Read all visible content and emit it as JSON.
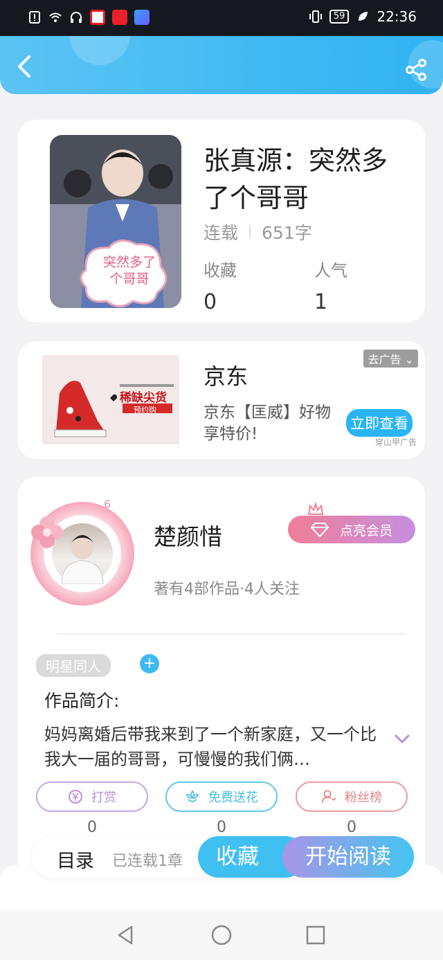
{
  "status_bar": {
    "time": "22:36",
    "battery": "59",
    "icons": [
      "alert-icon",
      "wifi-icon",
      "headset-icon",
      "weibo-icon",
      "news-icon",
      "music-icon",
      "vibrate-icon",
      "battery-icon",
      "leaf-icon"
    ]
  },
  "header": {
    "back_icon": "chevron-left-icon",
    "share_icon": "share-icon"
  },
  "book": {
    "cover_text": "突然多了个哥哥",
    "title": "张真源：突然多了个哥哥",
    "status": "连载",
    "word_count": "651字",
    "fav_label": "收藏",
    "fav_value": "0",
    "pop_label": "人气",
    "pop_value": "1"
  },
  "ad": {
    "image_headline": "稀缺尖货",
    "image_sub": "预约购",
    "title": "京东",
    "description": "京东【匡威】好物享特价!",
    "close_label": "去广告",
    "cta": "立即查看",
    "source": "穿山甲广告"
  },
  "author": {
    "level": "6",
    "name": "楚颜惜",
    "vip_label": "点亮会员",
    "stats": "著有4部作品·4人关注",
    "tag": "明星同人",
    "intro_label": "作品简介:",
    "intro": "妈妈离婚后带我来到了一个新家庭，又一个比我大一届的哥哥，可慢慢的我们俩…",
    "actions": [
      {
        "label": "打赏",
        "count": "0",
        "color": "#b98fdc",
        "icon": "coin-icon"
      },
      {
        "label": "免费送花",
        "count": "0",
        "color": "#45bde8",
        "icon": "flower-icon"
      },
      {
        "label": "粉丝榜",
        "count": "0",
        "color": "#e98383",
        "icon": "fan-icon"
      }
    ]
  },
  "read_bar": {
    "catalog": "目录",
    "chapters": "已连载1章",
    "favorite": "收藏",
    "start": "开始阅读"
  },
  "colors": {
    "accent": "#30b3f2",
    "vip": "#f07e97"
  }
}
